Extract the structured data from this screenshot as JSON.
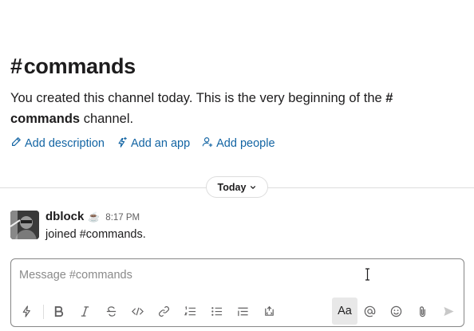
{
  "channel": {
    "hash": "#",
    "name": "commands"
  },
  "intro": {
    "text_before": "You created this channel today. This is the very beginning of the ",
    "channel_ref": "# commands",
    "text_after": " channel."
  },
  "actions": [
    {
      "label": "Add description",
      "icon": "pencil-icon"
    },
    {
      "label": "Add an app",
      "icon": "lightning-plus-icon"
    },
    {
      "label": "Add people",
      "icon": "add-person-icon"
    }
  ],
  "divider": {
    "label": "Today",
    "icon": "chevron-down-icon"
  },
  "message": {
    "author": "dblock",
    "status_emoji": "☕",
    "time": "8:17 PM",
    "text": "joined #commands."
  },
  "composer": {
    "placeholder": "Message #commands",
    "value": "",
    "toolbar": [
      "shortcuts-lightning-icon",
      "bold-icon",
      "italic-icon",
      "strikethrough-icon",
      "code-icon",
      "link-icon",
      "ordered-list-icon",
      "bulleted-list-icon",
      "blockquote-icon",
      "code-block-icon",
      "formatting-toggle-icon",
      "mention-icon",
      "emoji-icon",
      "attach-icon",
      "send-icon"
    ],
    "formatting_label": "Aa"
  },
  "colors": {
    "link": "#1264a3",
    "text": "#1d1c1d",
    "muted": "#616061",
    "border": "#dddddd"
  }
}
